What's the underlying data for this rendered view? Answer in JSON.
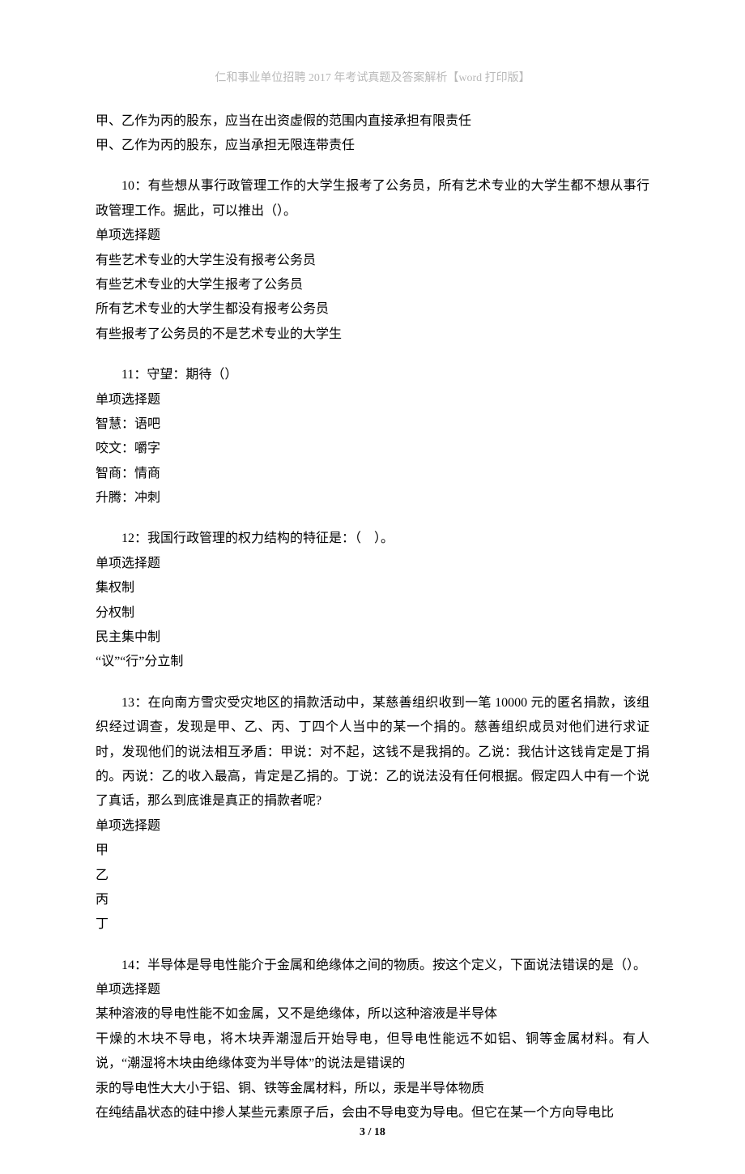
{
  "header": "仁和事业单位招聘 2017 年考试真题及答案解析【word 打印版】",
  "prelude": [
    "甲、乙作为丙的股东，应当在出资虚假的范围内直接承担有限责任",
    "甲、乙作为丙的股东，应当承担无限连带责任"
  ],
  "questions": [
    {
      "stem": "10：有些想从事行政管理工作的大学生报考了公务员，所有艺术专业的大学生都不想从事行政管理工作。据此，可以推出（）。",
      "type": "单项选择题",
      "options": [
        "有些艺术专业的大学生没有报考公务员",
        "有些艺术专业的大学生报考了公务员",
        "所有艺术专业的大学生都没有报考公务员",
        "有些报考了公务员的不是艺术专业的大学生"
      ]
    },
    {
      "stem": "11：守望：期待（）",
      "type": "单项选择题",
      "options": [
        "智慧：语吧",
        "咬文：嚼字",
        "智商：情商",
        "升腾：冲刺"
      ]
    },
    {
      "stem": "12：我国行政管理的权力结构的特征是：（　）。",
      "type": "单项选择题",
      "options": [
        "集权制",
        "分权制",
        "民主集中制",
        "“议”“行”分立制"
      ]
    },
    {
      "stem": "13：在向南方雪灾受灾地区的捐款活动中，某慈善组织收到一笔 10000 元的匿名捐款，该组织经过调查，发现是甲、乙、丙、丁四个人当中的某一个捐的。慈善组织成员对他们进行求证时，发现他们的说法相互矛盾：甲说：对不起，这钱不是我捐的。乙说：我估计这钱肯定是丁捐的。丙说：乙的收入最高，肯定是乙捐的。丁说：乙的说法没有任何根据。假定四人中有一个说了真话，那么到底谁是真正的捐款者呢?",
      "type": "单项选择题",
      "options": [
        "甲",
        "乙",
        "丙",
        "丁"
      ]
    },
    {
      "stem": "14：半导体是导电性能介于金属和绝缘体之间的物质。按这个定义，下面说法错误的是（）。",
      "type": "单项选择题",
      "options": [
        "某种溶液的导电性能不如金属，又不是绝缘体，所以这种溶液是半导体",
        "干燥的木块不导电，将木块弄潮湿后开始导电，但导电性能远不如铝、铜等金属材料。有人说，“潮湿将木块由绝缘体变为半导体”的说法是错误的",
        "汞的导电性大大小于铝、铜、铁等金属材料，所以，汞是半导体物质",
        "在纯结晶状态的硅中掺人某些元素原子后，会由不导电变为导电。但它在某一个方向导电比"
      ]
    }
  ],
  "pagenum": "3 / 18"
}
